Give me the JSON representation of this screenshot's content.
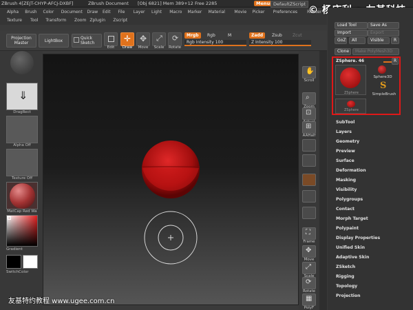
{
  "titlebar": {
    "app": "ZBrush 4[ZEJT-CHYP-AFCJ-DXBF]",
    "doc": "ZBrush Document",
    "obj": "[Obj 6821] Mem 389+12 Free 2285",
    "menus": "Menus",
    "script": "DefaultZScript"
  },
  "watermark": "© 杨庆利 • 友基科技",
  "menu_row1": [
    "Alpha",
    "Brush",
    "Color",
    "Document",
    "Draw",
    "Edit",
    "File",
    "Layer",
    "Light",
    "Macro",
    "Marker",
    "Material",
    "Movie",
    "Picker",
    "Preferences",
    "Render",
    "Stencil",
    "Stroke"
  ],
  "menu_row2": [
    "Texture",
    "Tool",
    "Transform",
    "Zoom",
    "Zplugin",
    "Zscript"
  ],
  "toolbar": {
    "projection": "Projection Master",
    "lightbox": "LightBox",
    "quicksketch": "Quick Sketch",
    "edit": "Edit",
    "draw": "Draw",
    "move": "Move",
    "scale": "Scale",
    "rotate": "Rotate",
    "mrgb": "Mrgb",
    "rgb": "Rgb",
    "m": "M",
    "rgb_intensity": "Rgb Intensity 100",
    "zadd": "Zadd",
    "zsub": "Zsub",
    "zcut": "Zcut",
    "z_intensity": "Z Intensity 100"
  },
  "left_shelf": {
    "dragrect": "DragRect",
    "alpha": "Alpha Off",
    "texture": "Texture Off",
    "material": "MatCap Red Wa",
    "gradient": "Gradient",
    "switchcolor": "SwitchColor"
  },
  "right_shelf": [
    "Scroll",
    "Zoom",
    "Actual",
    "AAHalf",
    "Frame",
    "Move",
    "Scale",
    "Rotate",
    "PolyF"
  ],
  "palette": {
    "load_tool": "Load Tool",
    "save_as": "Save As",
    "import": "Import",
    "export": "Export",
    "goz": "GoZ",
    "all": "All",
    "visible": "Visible",
    "r": "R",
    "clone": "Clone",
    "make_polymesh": "Make PolyMesh3D",
    "current_tool": "ZSphere. 46",
    "tool_items": [
      "ZSphere",
      "Sphere3D",
      "SimpleBrush",
      "ZSphere"
    ],
    "subpalettes": [
      "SubTool",
      "Layers",
      "Geometry",
      "Preview",
      "Surface",
      "Deformation",
      "Masking",
      "Visibility",
      "Polygroups",
      "Contact",
      "Morph Target",
      "Polypaint",
      "Display Properties",
      "Unified Skin",
      "Adaptive Skin",
      "ZSketch",
      "Rigging",
      "Topology",
      "Projection"
    ]
  },
  "caption": "友基特约教程 www.ugee.com.cn",
  "colors": {
    "accent": "#e0721c",
    "highlight_box": "#e01818",
    "sphere": "#b01010"
  }
}
